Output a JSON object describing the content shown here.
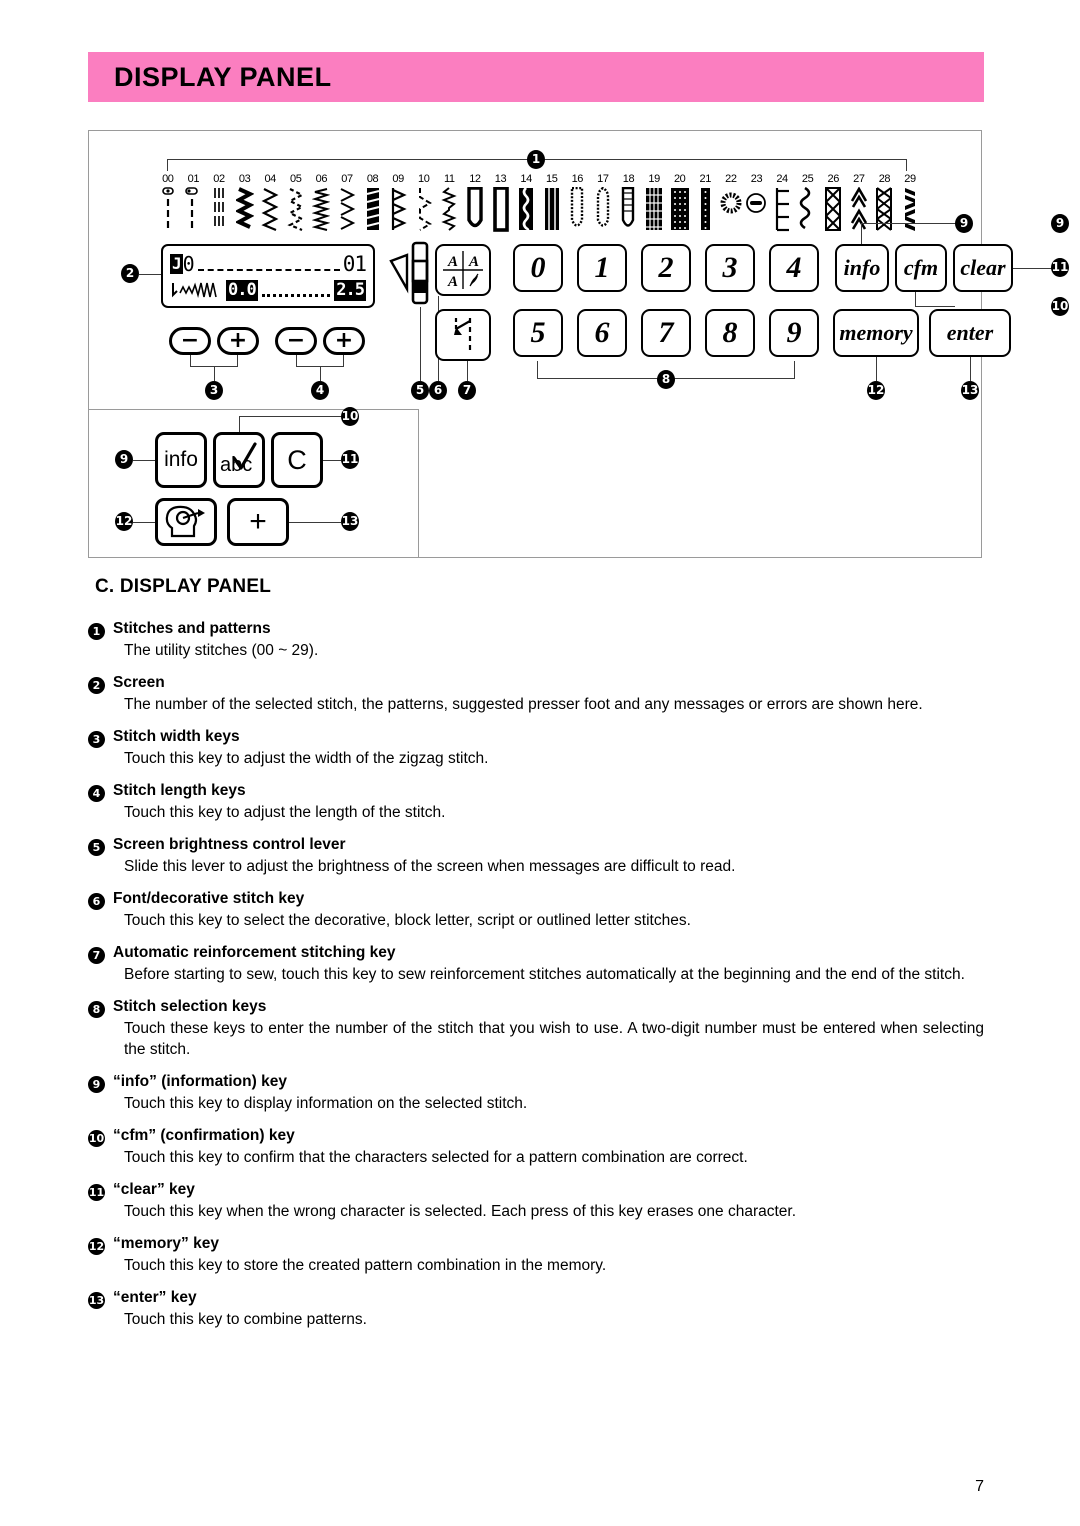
{
  "banner": {
    "title": "DISPLAY PANEL"
  },
  "diagram": {
    "callouts": [
      "1",
      "2",
      "3",
      "4",
      "5",
      "6",
      "7",
      "8",
      "9",
      "10",
      "11",
      "12",
      "13"
    ],
    "stitches": [
      {
        "num": "00",
        "icon": "straight-stitch-center"
      },
      {
        "num": "01",
        "icon": "straight-stitch-left"
      },
      {
        "num": "02",
        "icon": "triple-stretch-stitch"
      },
      {
        "num": "03",
        "icon": "zigzag-bold"
      },
      {
        "num": "04",
        "icon": "zigzag"
      },
      {
        "num": "05",
        "icon": "zigzag-dashed"
      },
      {
        "num": "06",
        "icon": "stretch-zigzag"
      },
      {
        "num": "07",
        "icon": "overlock-zigzag"
      },
      {
        "num": "08",
        "icon": "ladder-stitch"
      },
      {
        "num": "09",
        "icon": "overlock-stitch"
      },
      {
        "num": "10",
        "icon": "blind-hem-stitch"
      },
      {
        "num": "11",
        "icon": "stretch-blind-hem"
      },
      {
        "num": "12",
        "icon": "buttonhole-round-end"
      },
      {
        "num": "13",
        "icon": "buttonhole-square"
      },
      {
        "num": "14",
        "icon": "buttonhole-stretch"
      },
      {
        "num": "15",
        "icon": "buttonhole-dense"
      },
      {
        "num": "16",
        "icon": "keyhole-buttonhole"
      },
      {
        "num": "17",
        "icon": "keyhole-buttonhole-tapered"
      },
      {
        "num": "18",
        "icon": "bound-buttonhole"
      },
      {
        "num": "19",
        "icon": "darning-stitch"
      },
      {
        "num": "20",
        "icon": "bartack-wide"
      },
      {
        "num": "21",
        "icon": "bartack-narrow"
      },
      {
        "num": "22",
        "icon": "eyelet"
      },
      {
        "num": "23",
        "icon": "button-sewing"
      },
      {
        "num": "24",
        "icon": "ladder-rung"
      },
      {
        "num": "25",
        "icon": "scallop-stitch"
      },
      {
        "num": "26",
        "icon": "decorative-diamond"
      },
      {
        "num": "27",
        "icon": "decorative-arrow"
      },
      {
        "num": "28",
        "icon": "decorative-cross"
      },
      {
        "num": "29",
        "icon": "decorative-wave"
      }
    ],
    "screen": {
      "presser_foot": "J",
      "stitch_number": "01",
      "stitch_width": "0.0",
      "stitch_length": "2.5"
    },
    "width_keys": {
      "minus": "−",
      "plus": "+"
    },
    "length_keys": {
      "minus": "−",
      "plus": "+"
    },
    "keys": {
      "font": "font-decorative-stitch-key",
      "reinforcement": "automatic-reinforcement-key",
      "numbers_top": [
        "0",
        "1",
        "2",
        "3",
        "4"
      ],
      "numbers_bottom": [
        "5",
        "6",
        "7",
        "8",
        "9"
      ],
      "info": "info",
      "cfm": "cfm",
      "clear": "clear",
      "memory": "memory",
      "enter": "enter"
    },
    "inset_keys": {
      "info": "info",
      "abc": "abc",
      "clear": "C",
      "memory": "memory-head-icon",
      "enter": "+"
    }
  },
  "section": {
    "title": "C. DISPLAY PANEL",
    "items": [
      {
        "num": "1",
        "heading": "Stitches and patterns",
        "text": "The utility stitches (00 ~ 29)."
      },
      {
        "num": "2",
        "heading": "Screen",
        "text": "The number of the selected stitch, the patterns, suggested presser foot and any messages or errors are shown here."
      },
      {
        "num": "3",
        "heading": "Stitch width keys",
        "text": "Touch this key to adjust the width of the zigzag stitch."
      },
      {
        "num": "4",
        "heading": "Stitch length keys",
        "text": "Touch this key to adjust the length of the stitch."
      },
      {
        "num": "5",
        "heading": "Screen brightness control lever",
        "text": "Slide this lever to adjust the brightness of the screen when messages are difficult to read."
      },
      {
        "num": "6",
        "heading": "Font/decorative stitch key",
        "text": "Touch this key to select the decorative, block letter, script or outlined letter stitches."
      },
      {
        "num": "7",
        "heading": "Automatic reinforcement stitching key",
        "text": "Before starting to sew, touch this key to sew reinforcement stitches automatically at the beginning and the end of the stitch."
      },
      {
        "num": "8",
        "heading": "Stitch selection keys",
        "text": "Touch these keys to enter the number of the stitch that you wish to use. A two-digit number must be entered when selecting the stitch."
      },
      {
        "num": "9",
        "heading": "“info” (information) key",
        "text": "Touch this key to display information on the selected stitch."
      },
      {
        "num": "10",
        "heading": "“cfm” (confirmation) key",
        "text": "Touch this key to confirm that the characters selected for a pattern combination are correct."
      },
      {
        "num": "11",
        "heading": "“clear” key",
        "text": "Touch this key when the wrong character is selected. Each press of this key erases one character."
      },
      {
        "num": "12",
        "heading": "“memory” key",
        "text": "Touch this key to store the created pattern combination in the memory."
      },
      {
        "num": "13",
        "heading": "“enter” key",
        "text": "Touch this key to combine patterns."
      }
    ]
  },
  "footer": {
    "page": "7"
  }
}
